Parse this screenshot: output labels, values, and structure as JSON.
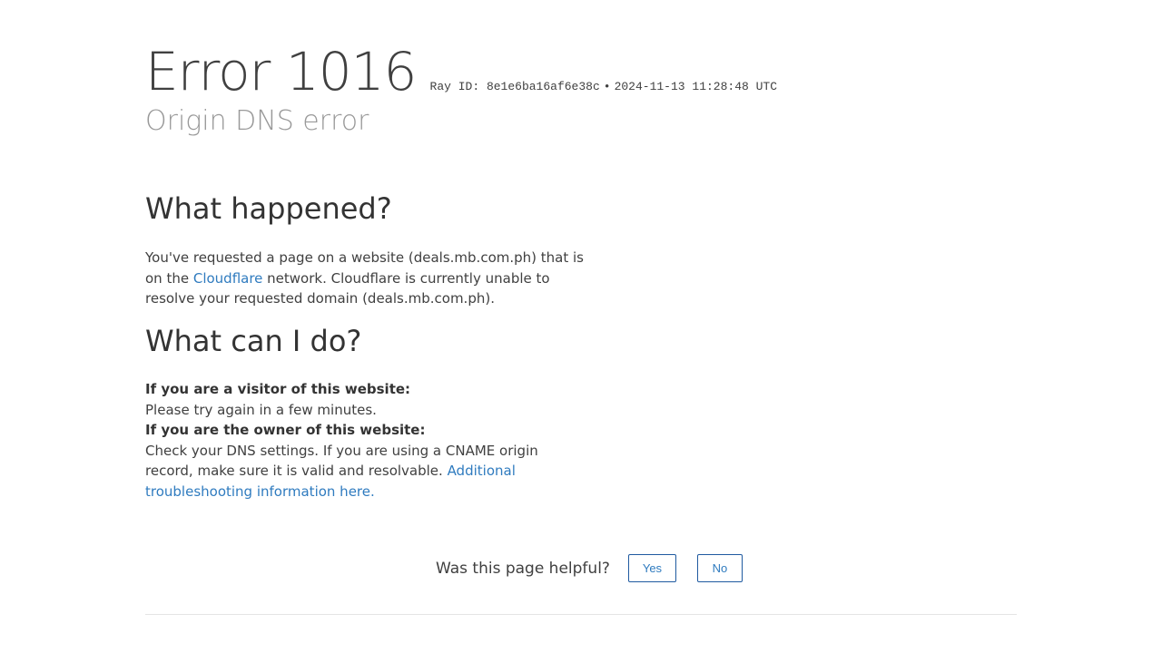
{
  "header": {
    "error_title": "Error 1016",
    "ray_id": "Ray ID: 8e1e6ba16af6e38c",
    "separator": "•",
    "timestamp": "2024-11-13 11:28:48 UTC",
    "subtitle": "Origin DNS error"
  },
  "what_happened": {
    "heading": "What happened?",
    "text_before_link": "You've requested a page on a website (deals.mb.com.ph) that is on the ",
    "link": "Cloudflare",
    "text_after_link": " network. Cloudflare is currently unable to resolve your requested domain (deals.mb.com.ph)."
  },
  "what_can_i_do": {
    "heading": "What can I do?",
    "visitor_heading": "If you are a visitor of this website:",
    "visitor_text": "Please try again in a few minutes.",
    "owner_heading": "If you are the owner of this website:",
    "owner_text": "Check your DNS settings. If you are using a CNAME origin record, make sure it is valid and resolvable. ",
    "owner_link": "Additional troubleshooting information here."
  },
  "feedback": {
    "question": "Was this page helpful?",
    "yes_label": "Yes",
    "no_label": "No"
  }
}
